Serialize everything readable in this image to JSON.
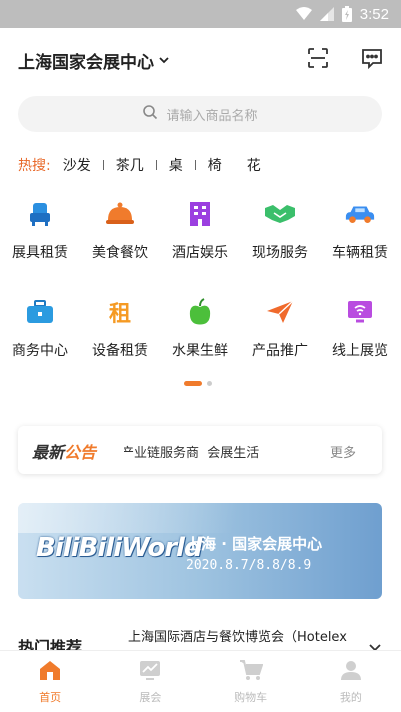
{
  "status_bar": {
    "time": "3:52"
  },
  "header": {
    "location": "上海国家会展中心"
  },
  "search": {
    "placeholder": "请输入商品名称"
  },
  "hot_search": {
    "label": "热搜:",
    "items": [
      "沙发",
      "茶几",
      "桌",
      "椅",
      "花"
    ]
  },
  "categories": [
    {
      "label": "展具租赁",
      "icon": "chair-icon",
      "color": "#2b8fe0"
    },
    {
      "label": "美食餐饮",
      "icon": "food-cloche-icon",
      "color": "#f07b2c"
    },
    {
      "label": "酒店娱乐",
      "icon": "hotel-building-icon",
      "color": "#9b3fe0"
    },
    {
      "label": "现场服务",
      "icon": "handshake-icon",
      "color": "#3bbf6b"
    },
    {
      "label": "车辆租赁",
      "icon": "car-icon",
      "color": "#3a8ef0"
    },
    {
      "label": "商务中心",
      "icon": "briefcase-icon",
      "color": "#2b9be0"
    },
    {
      "label": "设备租赁",
      "icon": "rent-icon",
      "color": "#f59a23",
      "glyph": "租"
    },
    {
      "label": "水果生鲜",
      "icon": "apple-icon",
      "color": "#4cbf3b"
    },
    {
      "label": "产品推广",
      "icon": "paper-plane-icon",
      "color": "#f06a2c"
    },
    {
      "label": "线上展览",
      "icon": "monitor-icon",
      "color": "#b94ce0"
    }
  ],
  "notice": {
    "title_a": "最新",
    "title_b": "公告",
    "text": "产业链服务商  会展生活",
    "more": "更多"
  },
  "banner": {
    "logo_text": "BiliBiliWorld",
    "title": "上海 · 国家会展中心",
    "date": "2020.8.7/8.8/8.9"
  },
  "recommend": {
    "title": "热门推荐",
    "marquee": "上海国际酒店与餐饮博览会（Hotelex"
  },
  "tabs": [
    {
      "label": "首页",
      "icon": "home-icon",
      "active": true
    },
    {
      "label": "展会",
      "icon": "exhibition-icon",
      "active": false
    },
    {
      "label": "购物车",
      "icon": "cart-icon",
      "active": false
    },
    {
      "label": "我的",
      "icon": "user-icon",
      "active": false
    }
  ],
  "colors": {
    "accent": "#f07b2c",
    "inactive": "#bbbbbb"
  }
}
